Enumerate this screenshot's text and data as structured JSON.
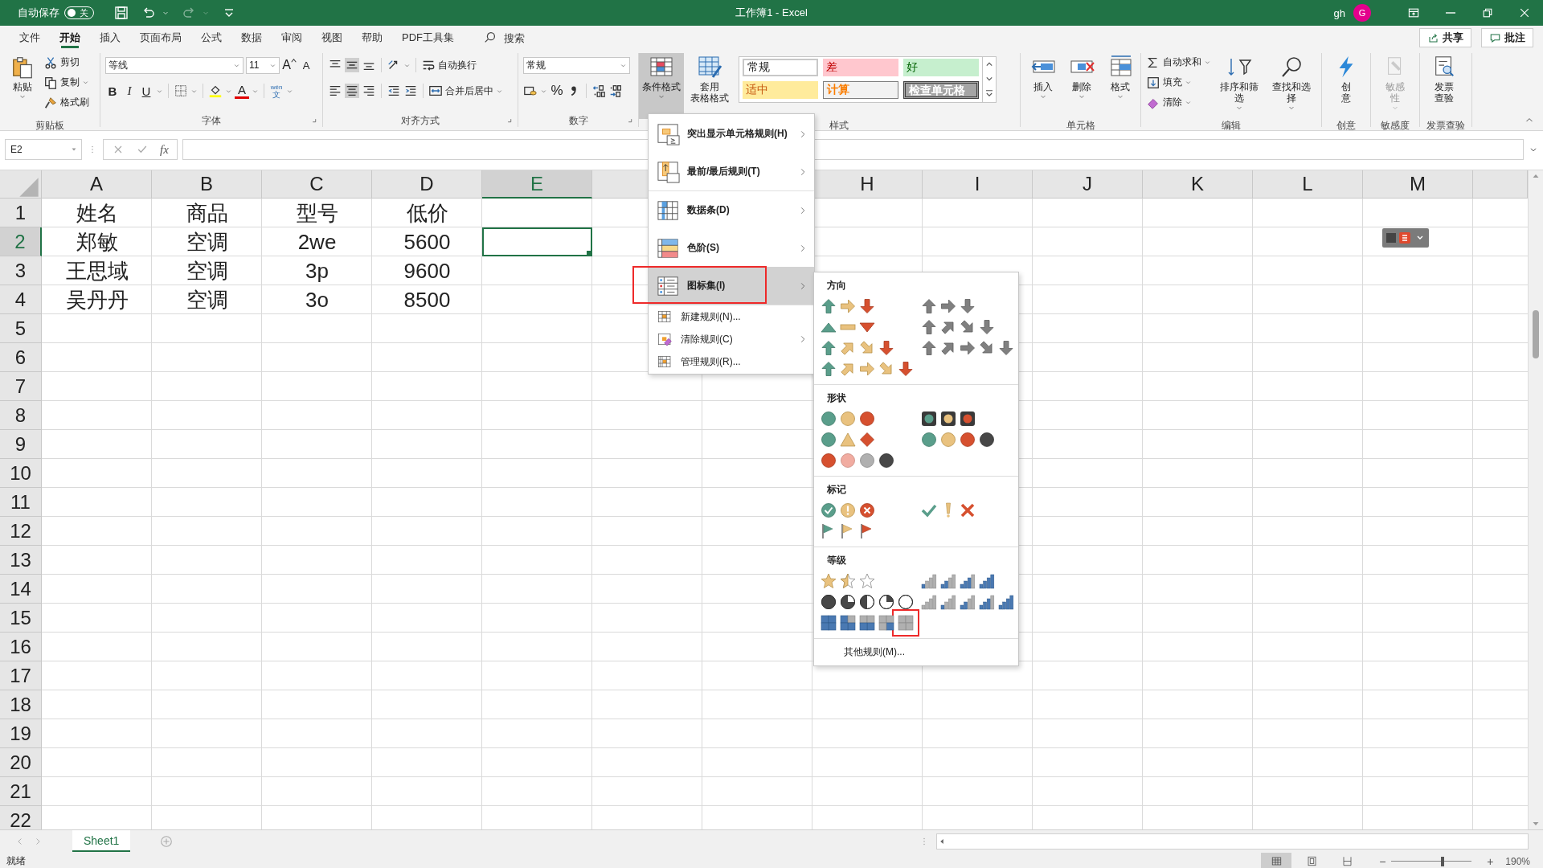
{
  "title_bar": {
    "autosave_label": "自动保存",
    "autosave_toggle": {
      "label": "关",
      "on": false
    },
    "quick_access": [
      {
        "kind": "save",
        "disabled": false
      },
      {
        "kind": "undo",
        "disabled": false
      },
      {
        "kind": "redo",
        "disabled": true
      },
      {
        "kind": "customize",
        "disabled": false
      }
    ],
    "title": "工作簿1  -  Excel",
    "user": "gh",
    "avatar": "G"
  },
  "ribbon_tabs": [
    {
      "label": "文件",
      "selected": false
    },
    {
      "label": "开始",
      "selected": true
    },
    {
      "label": "插入",
      "selected": false
    },
    {
      "label": "页面布局",
      "selected": false
    },
    {
      "label": "公式",
      "selected": false
    },
    {
      "label": "数据",
      "selected": false
    },
    {
      "label": "审阅",
      "selected": false
    },
    {
      "label": "视图",
      "selected": false
    },
    {
      "label": "帮助",
      "selected": false
    },
    {
      "label": "PDF工具集",
      "selected": false
    }
  ],
  "search": {
    "placeholder": "搜索"
  },
  "share_button": "共享",
  "comments_button": "批注",
  "ribbon": {
    "clipboard": {
      "paste": "粘贴",
      "cut": "剪切",
      "copy": "复制",
      "format_painter": "格式刷",
      "label": "剪贴板"
    },
    "font": {
      "font_name": "等线",
      "font_size": "11",
      "grow_font": "A",
      "shrink_font": "A",
      "bold": "B",
      "italic": "I",
      "underline": "U",
      "font_color": "A",
      "phonetic_top": "wén",
      "phonetic_bottom": "文",
      "label": "字体"
    },
    "alignment": {
      "wrap_text": "自动换行",
      "merge_center": "合并后居中",
      "label": "对齐方式"
    },
    "number": {
      "format": "常规",
      "percent": "%",
      "label": "数字"
    },
    "styles": {
      "conditional_formatting": {
        "label": "条件格式",
        "selected": true
      },
      "format_as_table": [
        "套用",
        "表格格式"
      ],
      "cell_styles": [
        {
          "label": "常规",
          "kind": "normal"
        },
        {
          "label": "差",
          "kind": "bad"
        },
        {
          "label": "好",
          "kind": "good"
        },
        {
          "label": "适中",
          "kind": "neutral"
        },
        {
          "label": "计算",
          "kind": "calculation"
        },
        {
          "label": "检查单元格",
          "kind": "check"
        }
      ],
      "label": "样式"
    },
    "cells": {
      "buttons": [
        {
          "label": "插入",
          "kind": "insert"
        },
        {
          "label": "删除",
          "kind": "delete"
        },
        {
          "label": "格式",
          "kind": "format"
        }
      ],
      "label": "单元格"
    },
    "editing": {
      "autosum": "自动求和",
      "fill": "填充",
      "clear": "清除",
      "sort_filter": "排序和筛选",
      "find_select": "查找和选择",
      "label": "编辑"
    },
    "extras": [
      {
        "lines": [
          "创",
          "意"
        ],
        "label": "创意",
        "disabled": false,
        "kind": "ideas"
      },
      {
        "lines": [
          "敏感",
          "性"
        ],
        "label": "敏感度",
        "disabled": true,
        "kind": "sensitivity"
      },
      {
        "lines": [
          "发票",
          "查验"
        ],
        "label": "发票查验",
        "disabled": false,
        "kind": "invoice"
      }
    ]
  },
  "formula_bar": {
    "name_box": "E2",
    "function_label": "fx"
  },
  "sheet": {
    "columns": [
      {
        "label": "A",
        "selected": false
      },
      {
        "label": "B",
        "selected": false
      },
      {
        "label": "C",
        "selected": false
      },
      {
        "label": "D",
        "selected": false
      },
      {
        "label": "E",
        "selected": true
      },
      {
        "selected": false
      },
      {},
      {
        "label": "H",
        "selected": false
      },
      {
        "label": "I",
        "selected": false
      },
      {
        "label": "J",
        "selected": false
      },
      {
        "label": "K",
        "selected": false
      },
      {
        "label": "L",
        "selected": false
      },
      {
        "label": "M",
        "selected": false
      }
    ],
    "rows": [
      {
        "header": "1",
        "selected": false,
        "cells": [
          "姓名",
          "商品",
          "型号",
          "低价"
        ]
      },
      {
        "header": "2",
        "selected": true,
        "cells": [
          "郑敏",
          "空调",
          "2we",
          "5600"
        ]
      },
      {
        "header": "3",
        "selected": false,
        "cells": [
          "王思域",
          "空调",
          "3p",
          "9600"
        ]
      },
      {
        "header": "4",
        "selected": false,
        "cells": [
          "吴丹丹",
          "空调",
          "3o",
          "8500"
        ]
      },
      {
        "header": "5",
        "selected": false
      },
      {
        "header": "6",
        "selected": false
      },
      {
        "header": "7",
        "selected": false
      },
      {
        "header": "8",
        "selected": false
      },
      {
        "header": "9",
        "selected": false
      },
      {
        "header": "10",
        "selected": false
      },
      {
        "header": "11",
        "selected": false
      },
      {
        "header": "12",
        "selected": false
      },
      {
        "header": "13",
        "selected": false
      },
      {
        "header": "14",
        "selected": false
      },
      {
        "header": "15",
        "selected": false
      },
      {
        "header": "16",
        "selected": false
      },
      {
        "header": "17",
        "selected": false
      },
      {
        "header": "18",
        "selected": false
      },
      {
        "header": "19",
        "selected": false
      },
      {
        "header": "20",
        "selected": false
      },
      {
        "header": "21",
        "selected": false
      },
      {
        "header": "22",
        "selected": false
      }
    ]
  },
  "menu": {
    "items": [
      {
        "label": "突出显示单元格规则(H)",
        "kind": "highlight",
        "submenu": true,
        "selected": false,
        "marked": false
      },
      {
        "label": "最前/最后规则(T)",
        "kind": "topbottom",
        "submenu": true,
        "selected": false,
        "marked": false
      },
      {
        "label": "数据条(D)",
        "kind": "databar",
        "submenu": true,
        "selected": false,
        "marked": false
      },
      {
        "label": "色阶(S)",
        "kind": "colorscale",
        "submenu": true,
        "selected": false,
        "marked": false
      },
      {
        "label": "图标集(I)",
        "kind": "iconset",
        "submenu": true,
        "selected": true,
        "marked": true
      },
      {
        "label": "新建规则(N)...",
        "kind": "new",
        "submenu": false,
        "selected": false,
        "marked": false
      },
      {
        "label": "清除规则(C)",
        "kind": "clear",
        "submenu": true,
        "selected": false,
        "marked": false
      },
      {
        "label": "管理规则(R)...",
        "kind": "manage",
        "submenu": false,
        "selected": false,
        "marked": false
      }
    ]
  },
  "icon_sets": {
    "sections": [
      {
        "title": "方向",
        "sets": [
          {
            "marked": false
          },
          {
            "marked": false
          },
          {
            "marked": false
          },
          {
            "marked": false
          },
          {
            "marked": false
          },
          {
            "marked": false
          },
          {
            "marked": false
          }
        ]
      },
      {
        "title": "形状",
        "sets": [
          {
            "marked": false
          },
          {
            "marked": false
          },
          {
            "marked": false
          },
          {
            "marked": false
          },
          {
            "marked": false
          }
        ]
      },
      {
        "title": "标记",
        "sets": [
          {
            "marked": false
          },
          {
            "marked": false
          },
          {
            "marked": false
          }
        ]
      },
      {
        "title": "等级",
        "sets": [
          {
            "marked": false
          },
          {
            "marked": false
          },
          {
            "marked": true
          },
          {
            "marked": false
          },
          {
            "marked": false
          }
        ]
      }
    ],
    "more_rules": "其他规则(M)..."
  },
  "sheet_tabs": [
    {
      "label": "Sheet1",
      "selected": true
    }
  ],
  "status_bar": {
    "status": "就绪",
    "views": [
      {
        "kind": "normal",
        "selected": true
      },
      {
        "kind": "page_layout",
        "selected": false
      },
      {
        "kind": "page_break",
        "selected": false
      }
    ],
    "zoom_out": "−",
    "zoom_in": "+",
    "zoom": {
      "level": 0.64,
      "label": "190%"
    }
  }
}
